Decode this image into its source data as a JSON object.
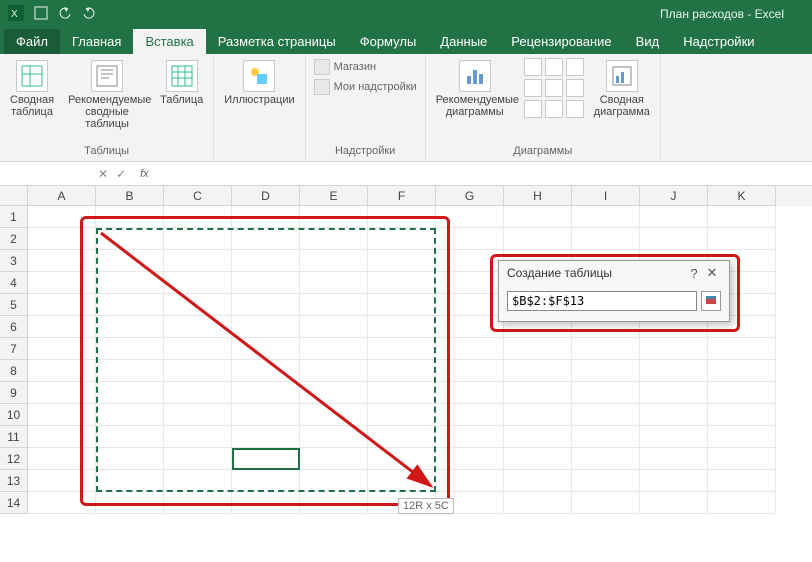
{
  "title": "План расходов - Excel",
  "tabs": {
    "file": "Файл",
    "home": "Главная",
    "insert": "Вставка",
    "layout": "Разметка страницы",
    "formulas": "Формулы",
    "data": "Данные",
    "review": "Рецензирование",
    "view": "Вид",
    "addins": "Надстройки"
  },
  "ribbon": {
    "tables": {
      "pivot": "Сводная\nтаблица",
      "recpivot": "Рекомендуемые\nсводные таблицы",
      "table": "Таблица",
      "label": "Таблицы"
    },
    "illus": {
      "btn": "Иллюстрации",
      "label": ""
    },
    "addins": {
      "store": "Магазин",
      "myaddins": "Мои надстройки",
      "label": "Надстройки"
    },
    "charts": {
      "rec": "Рекомендуемые\nдиаграммы",
      "pivotchart": "Сводная\nдиаграмма",
      "label": "Диаграммы"
    }
  },
  "formula_bar": {
    "namebox": "",
    "fx": "fx"
  },
  "columns": [
    "A",
    "B",
    "C",
    "D",
    "E",
    "F",
    "G",
    "H",
    "I",
    "J",
    "K"
  ],
  "rows": [
    "1",
    "2",
    "3",
    "4",
    "5",
    "6",
    "7",
    "8",
    "9",
    "10",
    "11",
    "12",
    "13",
    "14"
  ],
  "dialog": {
    "title": "Создание таблицы",
    "value": "$B$2:$F$13"
  },
  "sizehint": "12R x 5C"
}
